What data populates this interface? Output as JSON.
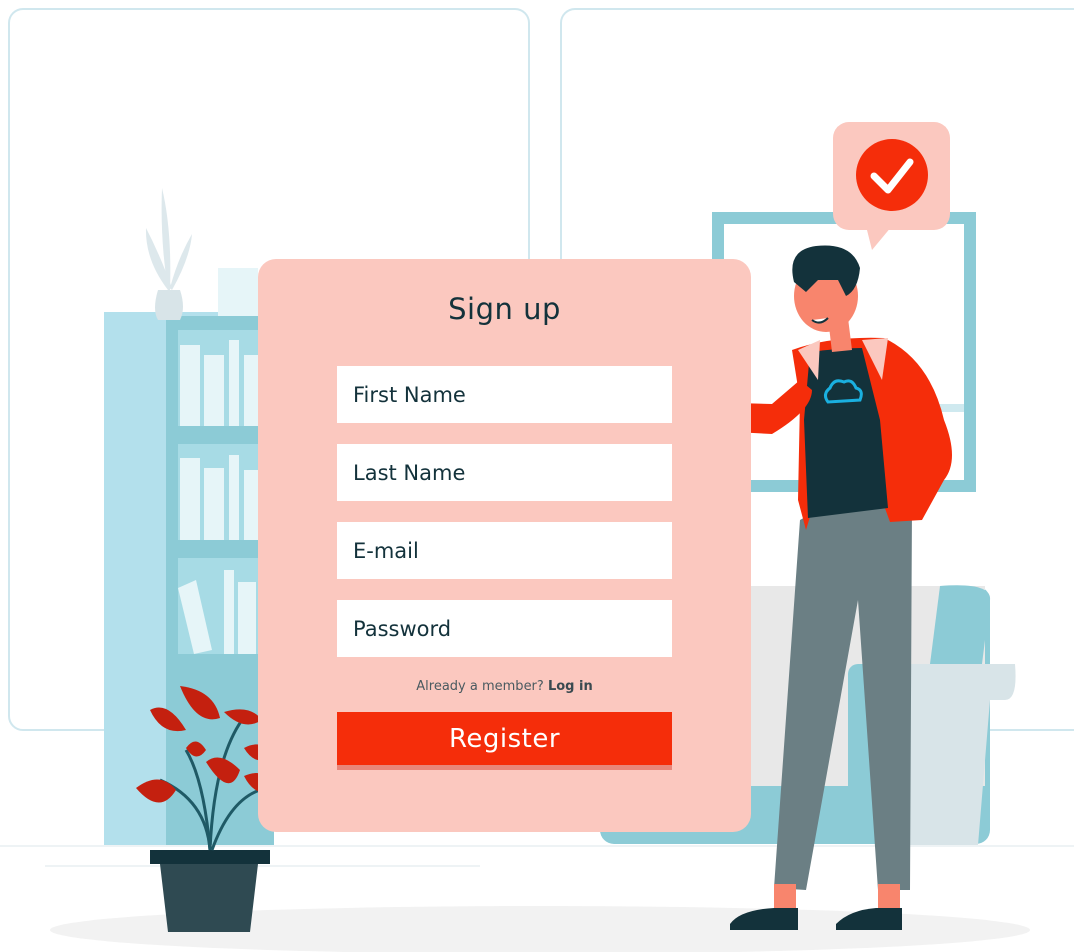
{
  "signup": {
    "title": "Sign up",
    "first_name_placeholder": "First Name",
    "last_name_placeholder": "Last Name",
    "email_placeholder": "E-mail",
    "password_placeholder": "Password",
    "member_prompt": "Already a member?",
    "login_label": "Log in",
    "register_label": "Register"
  },
  "colors": {
    "card": "#fbc8bf",
    "accent": "#f52d0a",
    "text": "#13323b",
    "shelf": "#b3e0ec",
    "jacket": "#f52d0a"
  },
  "icons": [
    "check-icon",
    "cloud-icon"
  ]
}
